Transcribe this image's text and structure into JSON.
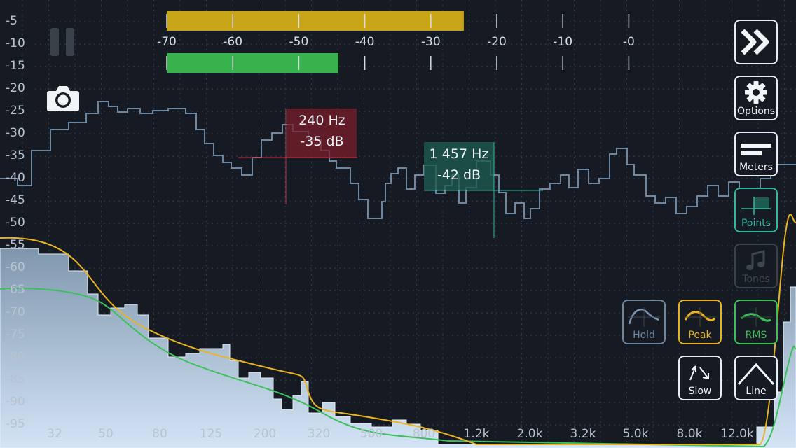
{
  "y_axis": {
    "labels": [
      "-5",
      "-10",
      "-15",
      "-20",
      "-25",
      "-30",
      "-35",
      "-40",
      "-45",
      "-50",
      "-55",
      "-60",
      "-65",
      "-70",
      "-75",
      "-80",
      "-85",
      "-90",
      "-95"
    ]
  },
  "x_axis": {
    "labels": [
      "32",
      "50",
      "80",
      "125",
      "200",
      "320",
      "500",
      "800",
      "1.2k",
      "2.0k",
      "3.2k",
      "5.0k",
      "8.0k",
      "12.0k"
    ]
  },
  "meter": {
    "scale_labels": [
      "-70",
      "-60",
      "-50",
      "-40",
      "-30",
      "-20",
      "-10",
      "-0"
    ],
    "peak_level_db": -25,
    "rms_level_db": -44,
    "peak_color": "#c8a417",
    "rms_color": "#37b24d"
  },
  "markers": [
    {
      "freq": "240 Hz",
      "level": "-35 dB",
      "color": "#7a1f2b"
    },
    {
      "freq": "1 457 Hz",
      "level": "-42 dB",
      "color": "#1d5a50"
    }
  ],
  "buttons": {
    "next": {
      "icon": "fast-forward-icon"
    },
    "options": {
      "label": "Options",
      "icon": "gear-icon"
    },
    "meters": {
      "label": "Meters",
      "icon": "meters-icon"
    },
    "points": {
      "label": "Points",
      "icon": "points-icon"
    },
    "tones": {
      "label": "Tones",
      "icon": "music-note-icon"
    },
    "hold": {
      "label": "Hold",
      "icon": "hold-curve-icon"
    },
    "peak": {
      "label": "Peak",
      "icon": "peak-curve-icon"
    },
    "rms": {
      "label": "RMS",
      "icon": "rms-curve-icon"
    },
    "slow": {
      "label": "Slow",
      "icon": "slow-arrows-icon"
    },
    "line": {
      "label": "Line",
      "icon": "line-graph-icon"
    }
  },
  "colors": {
    "background": "#161a22",
    "hold_curve": "#6e87a0",
    "peak_curve": "#e8b520",
    "rms_curve": "#3cc15a",
    "spectrum_fill": "#a9bfd6"
  }
}
